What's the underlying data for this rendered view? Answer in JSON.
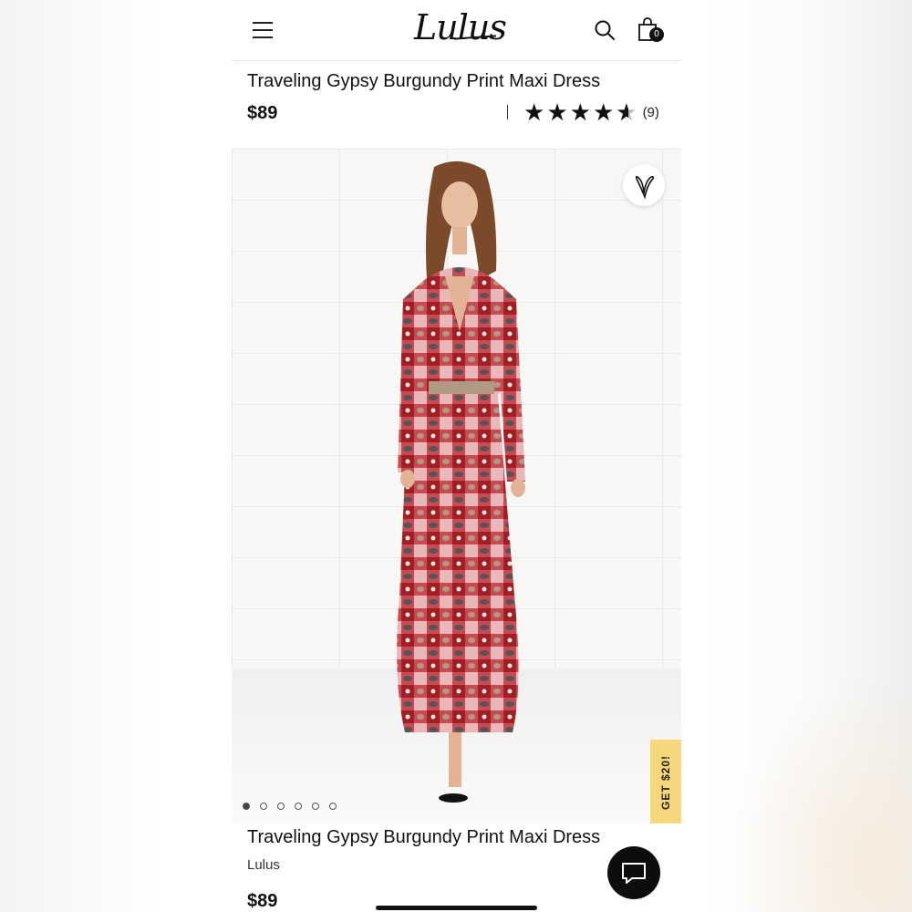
{
  "header": {
    "logo": "Lulus",
    "cart_count": "0"
  },
  "product": {
    "title": "Traveling Gypsy Burgundy Print Maxi Dress",
    "price": "$89",
    "rating_stars": 4.5,
    "rating_max": 5,
    "rating_count": "(9)",
    "brand": "Lulus"
  },
  "gallery": {
    "image_count": 6,
    "active_index": 0
  },
  "promo": {
    "label": "GET $20!"
  },
  "icons": {
    "menu": "hamburger-menu-icon",
    "search": "search-icon",
    "cart": "shopping-bag-icon",
    "wishlist": "heart-icon",
    "chat": "chat-bubble-icon"
  },
  "colors": {
    "promo_bg": "#f6d77b",
    "text": "#111111",
    "dress_burgundy": "#9e1f24"
  }
}
